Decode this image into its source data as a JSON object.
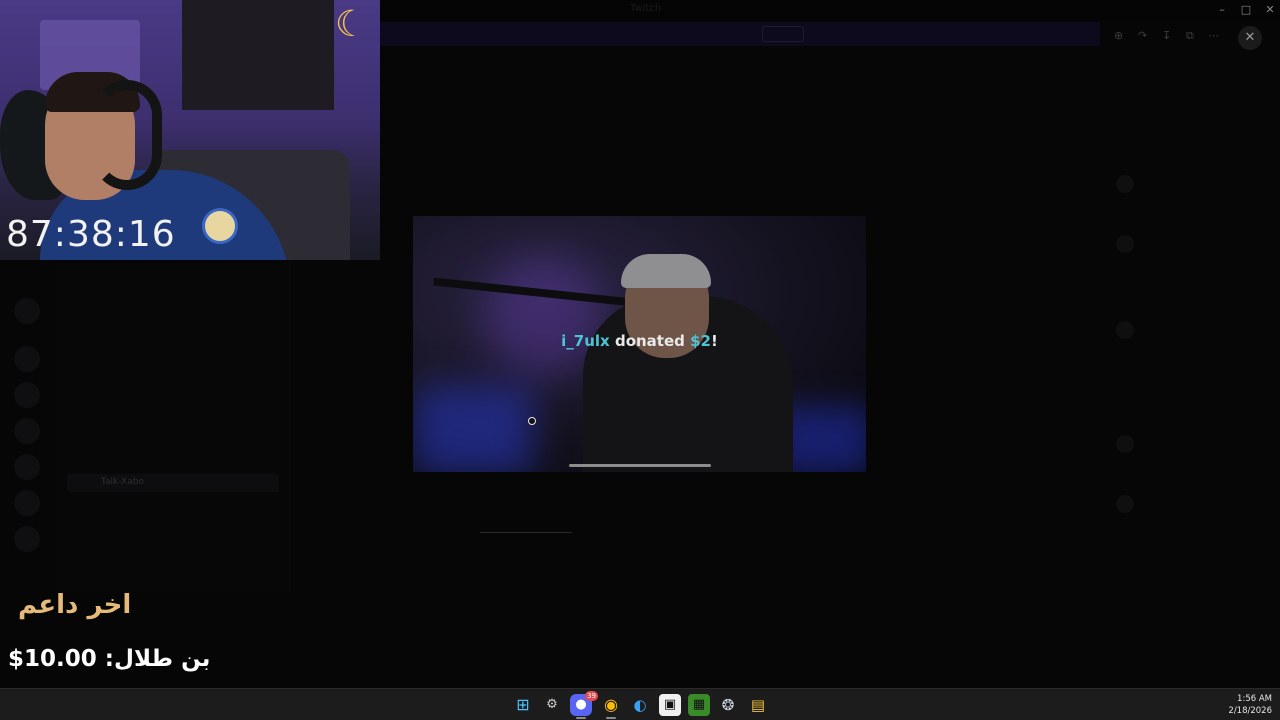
{
  "webcam": {
    "timer": "87:38:16",
    "moon_icon": "crescent-moon-stars-icon"
  },
  "window": {
    "title": "Twitch",
    "minimize_icon": "minimize-icon",
    "maximize_icon": "maximize-icon",
    "close_icon": "close-icon"
  },
  "viewer": {
    "tools": [
      "zoom-icon",
      "forward-icon",
      "download-icon",
      "open-external-icon",
      "more-icon"
    ],
    "close_icon": "close-icon",
    "donation": {
      "name": "i_7ulx",
      "text": "donated",
      "amount": "$2",
      "suffix": "!"
    }
  },
  "channels": {
    "active": "Talk-Xabo"
  },
  "supporter": {
    "title": "اخر داعم",
    "amount": "بن طلال: 10.00$"
  },
  "taskbar": {
    "icons": [
      "windows-start-icon",
      "settings-icon",
      "discord-icon",
      "chrome-icon",
      "edge-icon",
      "app-icon",
      "minecraft-icon",
      "steam-icon",
      "file-explorer-icon"
    ],
    "discord_badge": "39",
    "time": "1:56 AM",
    "date": "2/18/2026"
  },
  "colors": {
    "timer": "#f2f2f2",
    "supporter_title": "#e6bb7a",
    "donation_accent": "#4fc3d6",
    "taskbar_bg": "#1c1c1c"
  }
}
